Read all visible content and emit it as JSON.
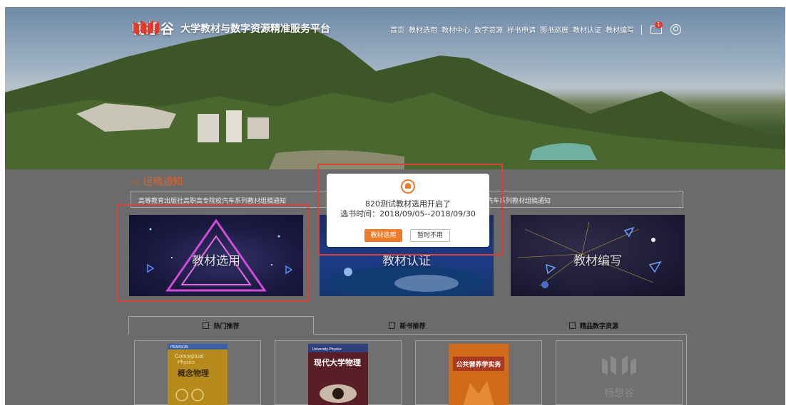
{
  "brand": {
    "name": "畅想谷",
    "subtitle": "大学教材与数字资源精准服务平台"
  },
  "nav": {
    "items": [
      "首页",
      "教材选用",
      "教材中心",
      "数字资源",
      "样书申请",
      "图书巡展",
      "教材认证",
      "教材编写"
    ],
    "mail_badge": "1"
  },
  "notice": {
    "title": "组稿通知",
    "items": [
      "高等教育出版社高职高专院校汽车系列教材组稿通知",
      "汽车系列教材组稿通知"
    ]
  },
  "tiles": [
    "教材选用",
    "教材认证",
    "教材编写"
  ],
  "tabs": [
    "热门推荐",
    "新书推荐",
    "精品数字资源"
  ],
  "books": {
    "b1": {
      "publisher": "PEARSON",
      "en1": "Conceptual",
      "en2": "Physics",
      "cn": "概念物理"
    },
    "b2": {
      "en": "University Physics",
      "cn": "现代大学物理"
    },
    "b3": {
      "cn": "公共营养学实务"
    },
    "b4": {
      "wordmark": "畅想谷"
    }
  },
  "modal": {
    "title": "820测试教材选用开启了",
    "time": "选书时间：2018/09/05--2018/09/30",
    "confirm": "教材选用",
    "cancel": "暂时不用"
  },
  "colors": {
    "accent": "#ef7a2a",
    "notice_title": "#d9622b",
    "highlight_box": "#d9433a"
  }
}
